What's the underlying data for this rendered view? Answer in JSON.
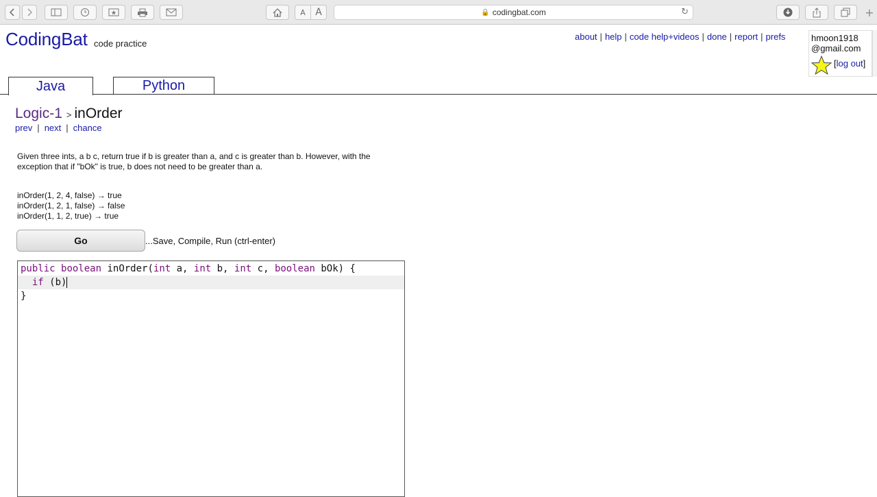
{
  "browser": {
    "url": "codingbat.com",
    "buttons": {
      "back": "back-icon",
      "forward": "forward-icon",
      "sidebar": "sidebar-icon",
      "history": "history-icon",
      "bookmarks": "bookmarks-icon",
      "print": "print-icon",
      "mail": "mail-icon",
      "home": "home-icon",
      "text_smaller": "A",
      "text_larger": "A",
      "downloads": "download-icon",
      "share": "share-icon",
      "tabs": "tabs-icon",
      "new_tab": "+"
    }
  },
  "site": {
    "brand": "CodingBat",
    "tagline": "code practice",
    "nav": [
      "about",
      "help",
      "code help+videos",
      "done",
      "report",
      "prefs"
    ],
    "user": {
      "email_line1": "hmoon1918",
      "email_line2": "@gmail.com",
      "logout_label": "log out"
    }
  },
  "tabs": [
    {
      "label": "Java",
      "active": true
    },
    {
      "label": "Python",
      "active": false
    }
  ],
  "problem": {
    "section": "Logic-1",
    "arrow": ">",
    "name": "inOrder",
    "subnav": [
      "prev",
      "next",
      "chance"
    ],
    "description": "Given three ints, a b c, return true if b is greater than a, and c is greater than b. However, with the exception that if \"bOk\" is true, b does not need to be greater than a.",
    "examples": [
      "inOrder(1, 2, 4, false) → true",
      "inOrder(1, 2, 1, false) → false",
      "inOrder(1, 1, 2, true) → true"
    ]
  },
  "actions": {
    "go_label": "Go",
    "go_hint": "...Save, Compile, Run (ctrl-enter)"
  },
  "editor": {
    "lines": [
      "public boolean inOrder(int a, int b, int c, boolean bOk) {",
      "  if (b)",
      "}"
    ],
    "colors": {
      "keyword": "#7a0f7a",
      "active_line": "#efefef"
    }
  },
  "colors": {
    "link": "#1a1aa6",
    "section": "#5a2a82"
  }
}
